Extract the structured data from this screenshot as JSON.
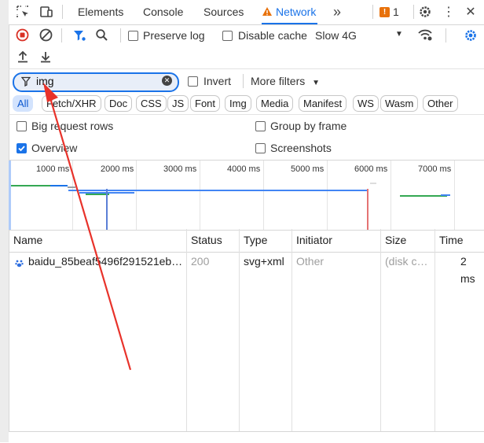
{
  "tabs": {
    "items": [
      "Elements",
      "Console",
      "Sources",
      "Network"
    ],
    "active": "Network",
    "issues_count": "1"
  },
  "toolbar": {
    "preserve_log": "Preserve log",
    "disable_cache": "Disable cache",
    "throttling": "Slow 4G"
  },
  "filter": {
    "value": "img",
    "invert": "Invert",
    "more_filters": "More filters"
  },
  "type_filters": [
    "All",
    "Fetch/XHR",
    "Doc",
    "CSS",
    "JS",
    "Font",
    "Img",
    "Media",
    "Manifest",
    "WS",
    "Wasm",
    "Other"
  ],
  "options": {
    "big_request_rows": "Big request rows",
    "group_by_frame": "Group by frame",
    "overview": "Overview",
    "screenshots": "Screenshots"
  },
  "timeline": {
    "ticks": [
      "1000 ms",
      "2000 ms",
      "3000 ms",
      "4000 ms",
      "5000 ms",
      "6000 ms",
      "7000 ms"
    ]
  },
  "table": {
    "columns": [
      "Name",
      "Status",
      "Type",
      "Initiator",
      "Size",
      "Time"
    ],
    "rows": [
      {
        "name": "baidu_85beaf5496f291521eb…",
        "status": "200",
        "type": "svg+xml",
        "initiator": "Other",
        "size": "(disk c…",
        "time": "2 ms"
      }
    ]
  },
  "colors": {
    "accent": "#1a73e8",
    "record": "#d93025",
    "annotation_arrow": "#e8322a"
  }
}
